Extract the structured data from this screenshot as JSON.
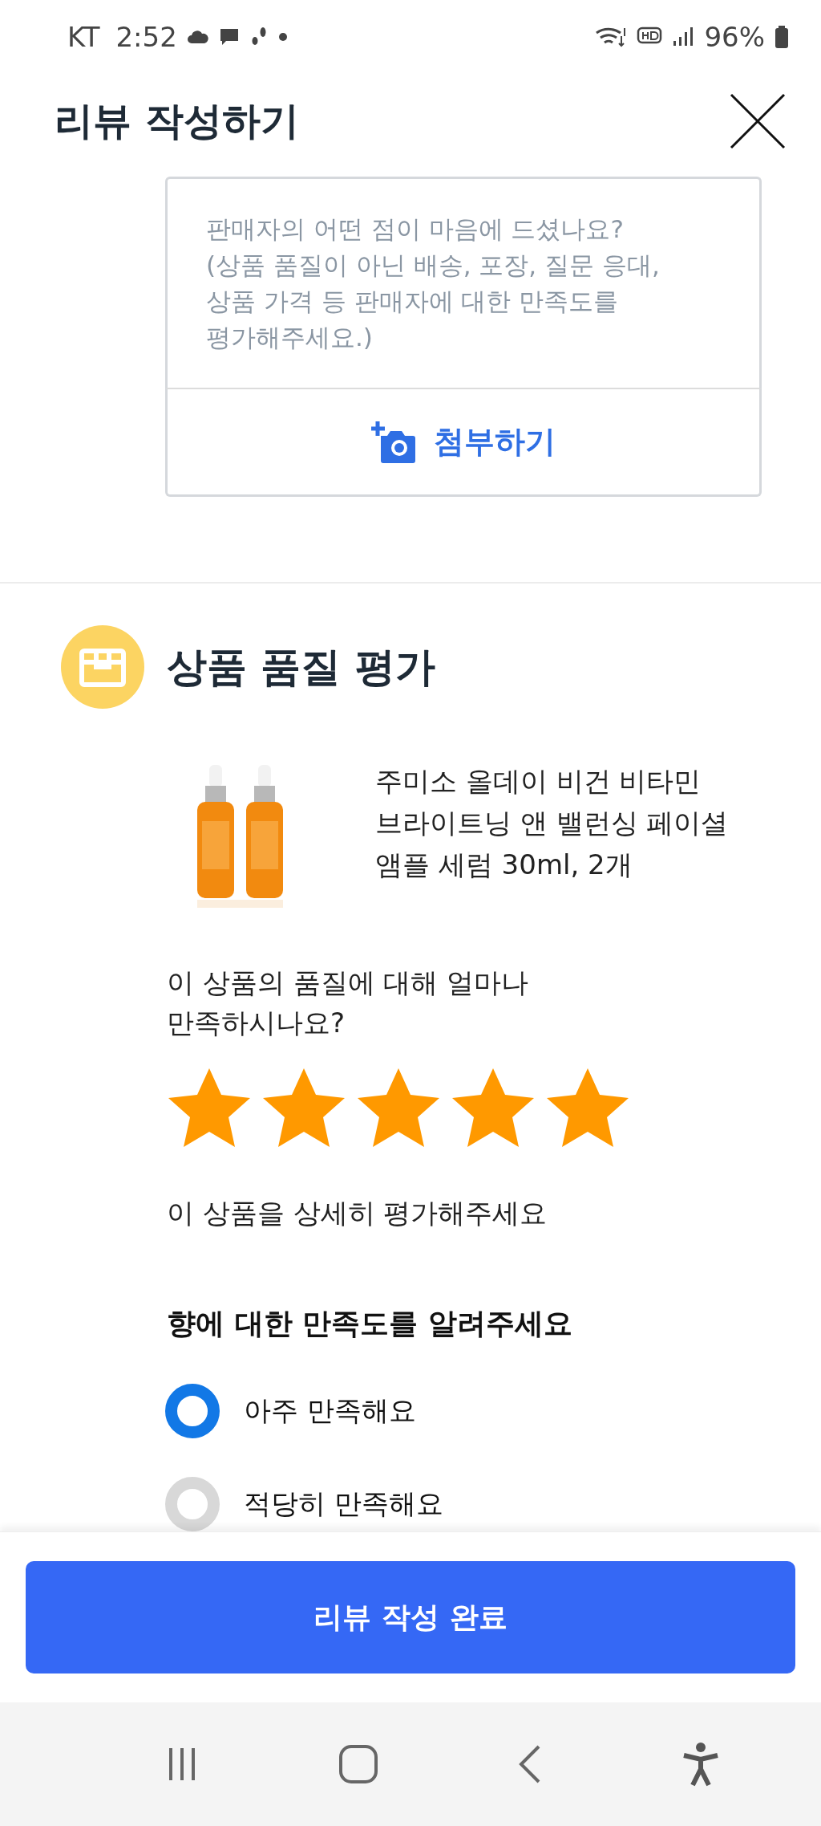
{
  "status_bar": {
    "carrier": "KT",
    "time": "2:52",
    "battery": "96%"
  },
  "header": {
    "title": "리뷰 작성하기"
  },
  "seller_review": {
    "placeholder": "판매자의 어떤 점이 마음에 드셨나요?\n(상품 품질이 아닌 배송, 포장, 질문 응대,\n상품 가격 등 판매자에 대한 만족도를\n평가해주세요.)",
    "attach_button": "첨부하기"
  },
  "quality_section": {
    "title": "상품 품질 평가",
    "product": {
      "name": "주미소 올데이 비건 비타민 브라이트닝 앤 밸런싱 페이셜 앰플 세럼 30ml, 2개"
    },
    "question": "이 상품의 품질에 대해 얼마나 만족하시나요?",
    "rating": {
      "stars": 5
    },
    "detail_prompt": "이 상품을 상세히 평가해주세요",
    "scent": {
      "title": "향에 대한 만족도를 알려주세요",
      "options": [
        {
          "label": "아주 만족해요",
          "selected": true
        },
        {
          "label": "적당히 만족해요",
          "selected": false
        }
      ]
    }
  },
  "submit_button": "리뷰 작성 완료"
}
